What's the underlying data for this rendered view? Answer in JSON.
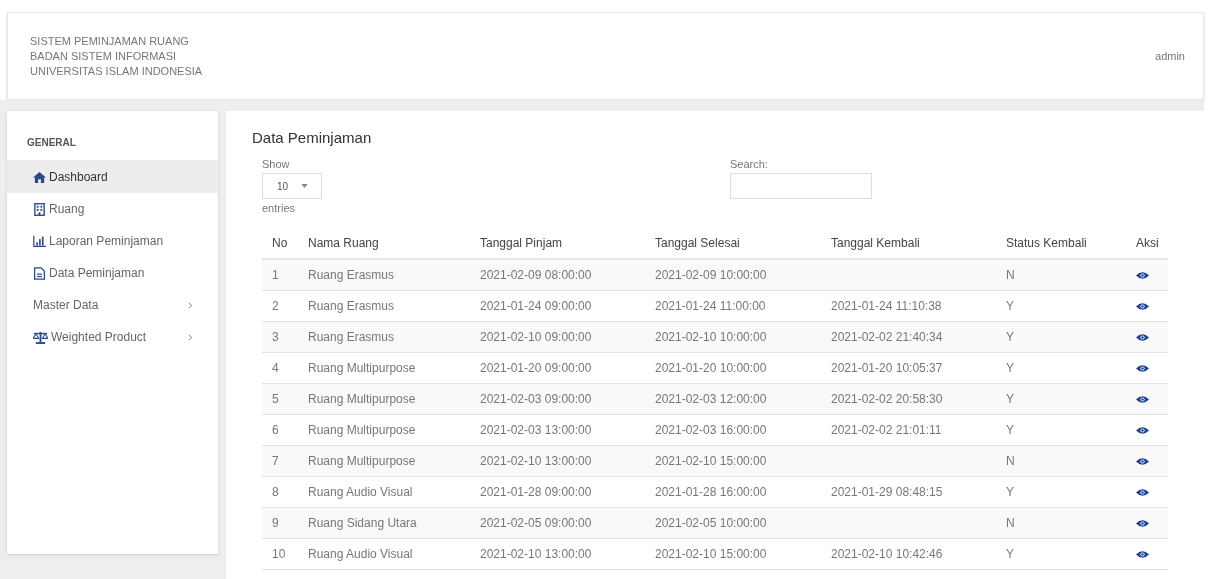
{
  "header": {
    "title_lines": [
      "SISTEM PEMINJAMAN RUANG",
      "BADAN SISTEM INFORMASI",
      "UNIVERSITAS ISLAM INDONESIA"
    ],
    "user": "admin"
  },
  "sidebar": {
    "section": "GENERAL",
    "items": [
      {
        "label": "Dashboard",
        "kind": "home",
        "selected": true,
        "submenu": false
      },
      {
        "label": "Ruang",
        "kind": "building",
        "selected": false,
        "submenu": false
      },
      {
        "label": "Laporan Peminjaman",
        "kind": "chart",
        "selected": false,
        "submenu": false
      },
      {
        "label": "Data Peminjaman",
        "kind": "document",
        "selected": false,
        "submenu": false
      },
      {
        "label": "Master Data",
        "kind": "plain",
        "selected": false,
        "submenu": true
      },
      {
        "label": "Weighted Product",
        "kind": "scale",
        "selected": false,
        "submenu": true
      }
    ]
  },
  "content": {
    "title": "Data Peminjaman",
    "length": {
      "show_label": "Show",
      "value": "10",
      "entries_label": "entries"
    },
    "search": {
      "label": "Search:"
    },
    "table": {
      "columns": [
        "No",
        "Nama Ruang",
        "Tanggal Pinjam",
        "Tanggal Selesai",
        "Tanggal Kembali",
        "Status Kembali",
        "Aksi"
      ],
      "rows": [
        [
          "1",
          "Ruang Erasmus",
          "2021-02-09 08:00:00",
          "2021-02-09 10:00:00",
          "",
          "N"
        ],
        [
          "2",
          "Ruang Erasmus",
          "2021-01-24 09:00:00",
          "2021-01-24 11:00:00",
          "2021-01-24 11:10:38",
          "Y"
        ],
        [
          "3",
          "Ruang Erasmus",
          "2021-02-10 09:00:00",
          "2021-02-10 10:00:00",
          "2021-02-02 21:40:34",
          "Y"
        ],
        [
          "4",
          "Ruang Multipurpose",
          "2021-01-20 09:00:00",
          "2021-01-20 10:00:00",
          "2021-01-20 10:05:37",
          "Y"
        ],
        [
          "5",
          "Ruang Multipurpose",
          "2021-02-03 09:00:00",
          "2021-02-03 12:00:00",
          "2021-02-02 20:58:30",
          "Y"
        ],
        [
          "6",
          "Ruang Multipurpose",
          "2021-02-03 13:00:00",
          "2021-02-03 16:00:00",
          "2021-02-02 21:01:11",
          "Y"
        ],
        [
          "7",
          "Ruang Multipurpose",
          "2021-02-10 13:00:00",
          "2021-02-10 15:00:00",
          "",
          "N"
        ],
        [
          "8",
          "Ruang Audio Visual",
          "2021-01-28 09:00:00",
          "2021-01-28 16:00:00",
          "2021-01-29 08:48:15",
          "Y"
        ],
        [
          "9",
          "Ruang Sidang Utara",
          "2021-02-05 09:00:00",
          "2021-02-05 10:00:00",
          "",
          "N"
        ],
        [
          "10",
          "Ruang Audio Visual",
          "2021-02-10 13:00:00",
          "2021-02-10 15:00:00",
          "2021-02-10 10:42:46",
          "Y"
        ]
      ]
    }
  }
}
